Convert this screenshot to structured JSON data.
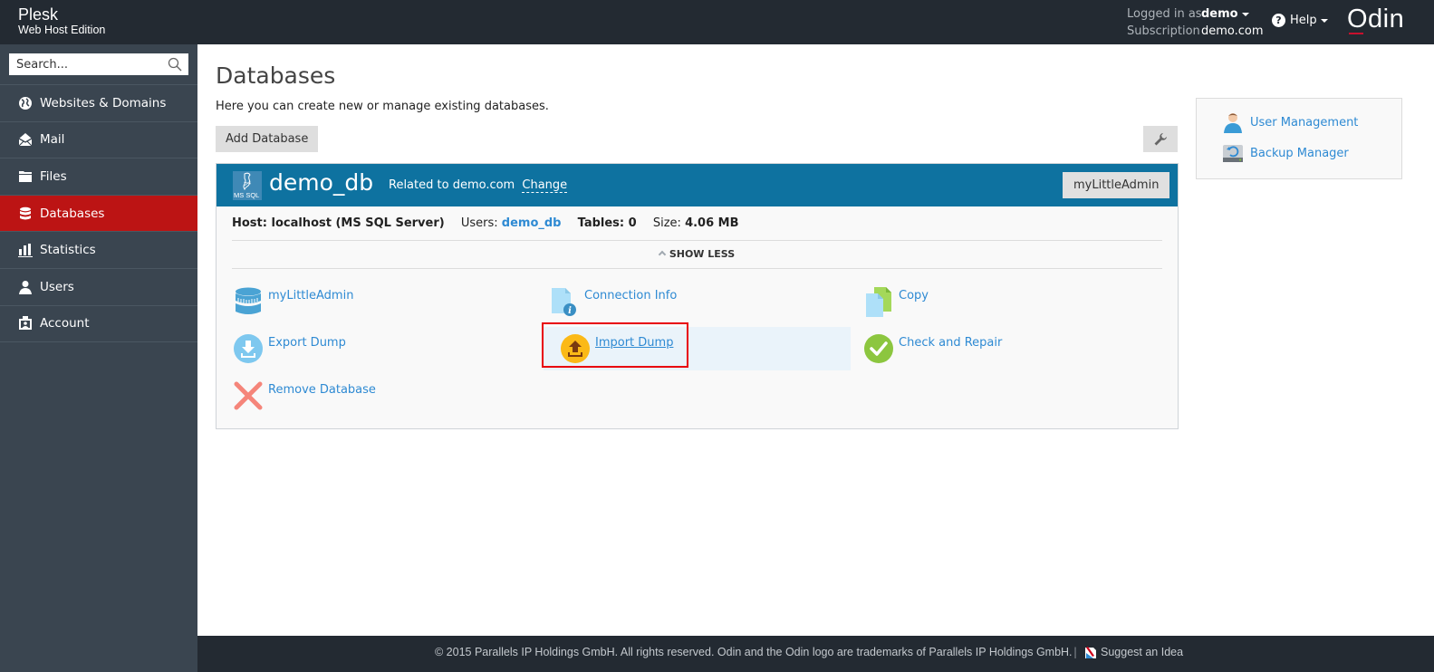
{
  "header": {
    "brand_title": "Plesk",
    "brand_subtitle": "Web Host Edition",
    "logged_in_label": "Logged in as",
    "logged_in_user": "demo",
    "subscription_label": "Subscription",
    "subscription_value": "demo.com",
    "help_label": "Help",
    "vendor_logo": "Odin"
  },
  "sidebar": {
    "search_placeholder": "Search...",
    "items": [
      {
        "label": "Websites & Domains",
        "icon": "globe-icon",
        "active": false
      },
      {
        "label": "Mail",
        "icon": "mail-icon",
        "active": false
      },
      {
        "label": "Files",
        "icon": "folder-icon",
        "active": false
      },
      {
        "label": "Databases",
        "icon": "database-icon",
        "active": true
      },
      {
        "label": "Statistics",
        "icon": "bar-chart-icon",
        "active": false
      },
      {
        "label": "Users",
        "icon": "user-icon",
        "active": false
      },
      {
        "label": "Account",
        "icon": "account-icon",
        "active": false
      }
    ]
  },
  "main": {
    "title": "Databases",
    "description": "Here you can create new or manage existing databases.",
    "add_button": "Add Database",
    "tools_icon": "wrench-icon",
    "database": {
      "engine_badge": "MS SQL",
      "name": "demo_db",
      "related_text": "Related to demo.com",
      "change_link": "Change",
      "admin_button": "myLittleAdmin",
      "host_label": "Host: localhost (MS SQL Server)",
      "users_label": "Users:",
      "users_value": "demo_db",
      "tables_label": "Tables: 0",
      "size_label": "Size:",
      "size_value": "4.06 MB",
      "toggle_label": "SHOW LESS",
      "actions": [
        {
          "label": "myLittleAdmin",
          "icon": "database-stack-icon"
        },
        {
          "label": "Connection Info",
          "icon": "connection-info-icon"
        },
        {
          "label": "Copy",
          "icon": "copy-icon"
        },
        {
          "label": "Export Dump",
          "icon": "export-icon"
        },
        {
          "label": "Import Dump",
          "icon": "import-icon",
          "hovered": true
        },
        {
          "label": "Check and Repair",
          "icon": "check-icon"
        },
        {
          "label": "Remove Database",
          "icon": "remove-icon"
        }
      ]
    }
  },
  "right_panel": {
    "links": [
      {
        "label": "User Management",
        "icon": "user-management-icon"
      },
      {
        "label": "Backup Manager",
        "icon": "backup-manager-icon"
      }
    ]
  },
  "footer": {
    "copyright": "© 2015 Parallels IP Holdings GmbH. All rights reserved. Odin and the Odin logo are trademarks of Parallels IP Holdings GmbH.",
    "separator": "|",
    "suggest_label": "Suggest an Idea"
  },
  "colors": {
    "header_bg": "#232a32",
    "sidebar_bg": "#3a4550",
    "active_nav": "#bc1414",
    "db_header": "#0e72a0",
    "link": "#2e8ad3",
    "highlight": "#e8000b"
  }
}
